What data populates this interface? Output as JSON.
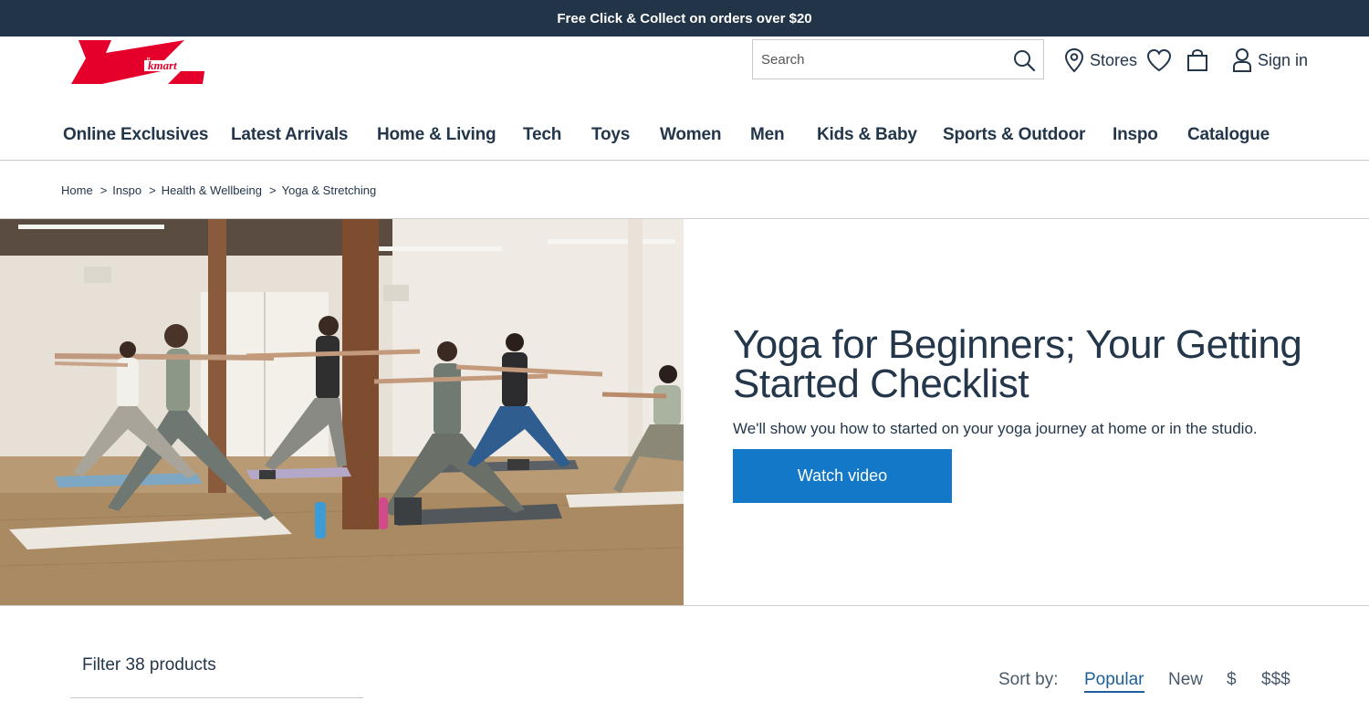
{
  "promo": {
    "text": "Free Click & Collect on orders over $20"
  },
  "brand": {
    "logo_text": "kmart",
    "colors": {
      "primary_red": "#e4002b",
      "dark_navy": "#223447",
      "button_blue": "#1478c8"
    }
  },
  "header": {
    "search_placeholder": "Search",
    "stores_label": "Stores",
    "sign_in_label": "Sign in"
  },
  "nav": {
    "items": [
      {
        "label": "Online Exclusives"
      },
      {
        "label": "Latest Arrivals"
      },
      {
        "label": "Home & Living"
      },
      {
        "label": "Tech"
      },
      {
        "label": "Toys"
      },
      {
        "label": "Women"
      },
      {
        "label": "Men"
      },
      {
        "label": "Kids & Baby"
      },
      {
        "label": "Sports & Outdoor"
      },
      {
        "label": "Inspo"
      },
      {
        "label": "Catalogue"
      }
    ]
  },
  "breadcrumb": {
    "items": [
      {
        "label": "Home"
      },
      {
        "label": "Inspo"
      },
      {
        "label": "Health & Wellbeing"
      },
      {
        "label": "Yoga & Stretching"
      }
    ],
    "separator": ">"
  },
  "hero": {
    "title": "Yoga for Beginners; Your Getting Started Checklist",
    "subtitle": "We'll show you how to started on your yoga journey at home or in the studio.",
    "button_label": "Watch video"
  },
  "filter": {
    "title": "Filter 38 products"
  },
  "sort": {
    "label": "Sort by:",
    "options": [
      {
        "label": "Popular",
        "active": true
      },
      {
        "label": "New"
      },
      {
        "label": "$"
      },
      {
        "label": "$$$"
      }
    ]
  }
}
